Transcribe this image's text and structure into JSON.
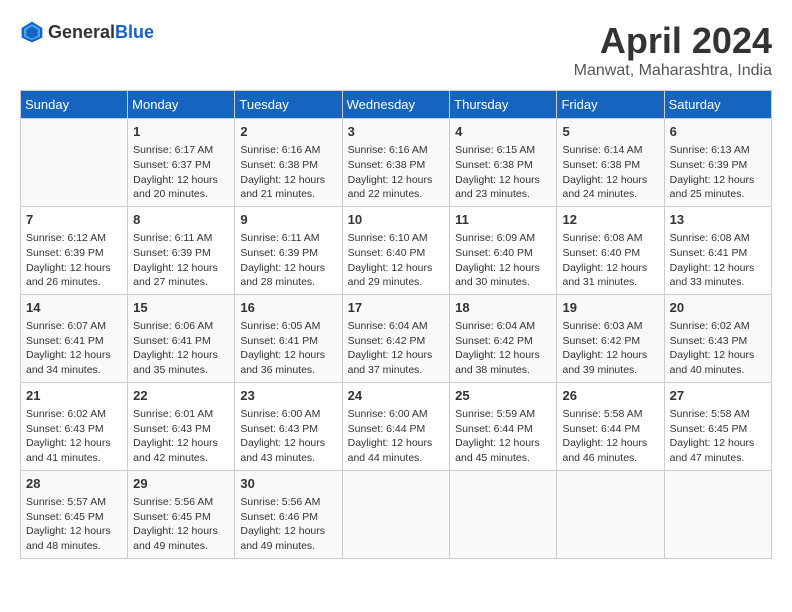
{
  "header": {
    "logo_general": "General",
    "logo_blue": "Blue",
    "month_year": "April 2024",
    "location": "Manwat, Maharashtra, India"
  },
  "calendar": {
    "days_of_week": [
      "Sunday",
      "Monday",
      "Tuesday",
      "Wednesday",
      "Thursday",
      "Friday",
      "Saturday"
    ],
    "weeks": [
      [
        {
          "day": "",
          "info": ""
        },
        {
          "day": "1",
          "info": "Sunrise: 6:17 AM\nSunset: 6:37 PM\nDaylight: 12 hours\nand 20 minutes."
        },
        {
          "day": "2",
          "info": "Sunrise: 6:16 AM\nSunset: 6:38 PM\nDaylight: 12 hours\nand 21 minutes."
        },
        {
          "day": "3",
          "info": "Sunrise: 6:16 AM\nSunset: 6:38 PM\nDaylight: 12 hours\nand 22 minutes."
        },
        {
          "day": "4",
          "info": "Sunrise: 6:15 AM\nSunset: 6:38 PM\nDaylight: 12 hours\nand 23 minutes."
        },
        {
          "day": "5",
          "info": "Sunrise: 6:14 AM\nSunset: 6:38 PM\nDaylight: 12 hours\nand 24 minutes."
        },
        {
          "day": "6",
          "info": "Sunrise: 6:13 AM\nSunset: 6:39 PM\nDaylight: 12 hours\nand 25 minutes."
        }
      ],
      [
        {
          "day": "7",
          "info": "Sunrise: 6:12 AM\nSunset: 6:39 PM\nDaylight: 12 hours\nand 26 minutes."
        },
        {
          "day": "8",
          "info": "Sunrise: 6:11 AM\nSunset: 6:39 PM\nDaylight: 12 hours\nand 27 minutes."
        },
        {
          "day": "9",
          "info": "Sunrise: 6:11 AM\nSunset: 6:39 PM\nDaylight: 12 hours\nand 28 minutes."
        },
        {
          "day": "10",
          "info": "Sunrise: 6:10 AM\nSunset: 6:40 PM\nDaylight: 12 hours\nand 29 minutes."
        },
        {
          "day": "11",
          "info": "Sunrise: 6:09 AM\nSunset: 6:40 PM\nDaylight: 12 hours\nand 30 minutes."
        },
        {
          "day": "12",
          "info": "Sunrise: 6:08 AM\nSunset: 6:40 PM\nDaylight: 12 hours\nand 31 minutes."
        },
        {
          "day": "13",
          "info": "Sunrise: 6:08 AM\nSunset: 6:41 PM\nDaylight: 12 hours\nand 33 minutes."
        }
      ],
      [
        {
          "day": "14",
          "info": "Sunrise: 6:07 AM\nSunset: 6:41 PM\nDaylight: 12 hours\nand 34 minutes."
        },
        {
          "day": "15",
          "info": "Sunrise: 6:06 AM\nSunset: 6:41 PM\nDaylight: 12 hours\nand 35 minutes."
        },
        {
          "day": "16",
          "info": "Sunrise: 6:05 AM\nSunset: 6:41 PM\nDaylight: 12 hours\nand 36 minutes."
        },
        {
          "day": "17",
          "info": "Sunrise: 6:04 AM\nSunset: 6:42 PM\nDaylight: 12 hours\nand 37 minutes."
        },
        {
          "day": "18",
          "info": "Sunrise: 6:04 AM\nSunset: 6:42 PM\nDaylight: 12 hours\nand 38 minutes."
        },
        {
          "day": "19",
          "info": "Sunrise: 6:03 AM\nSunset: 6:42 PM\nDaylight: 12 hours\nand 39 minutes."
        },
        {
          "day": "20",
          "info": "Sunrise: 6:02 AM\nSunset: 6:43 PM\nDaylight: 12 hours\nand 40 minutes."
        }
      ],
      [
        {
          "day": "21",
          "info": "Sunrise: 6:02 AM\nSunset: 6:43 PM\nDaylight: 12 hours\nand 41 minutes."
        },
        {
          "day": "22",
          "info": "Sunrise: 6:01 AM\nSunset: 6:43 PM\nDaylight: 12 hours\nand 42 minutes."
        },
        {
          "day": "23",
          "info": "Sunrise: 6:00 AM\nSunset: 6:43 PM\nDaylight: 12 hours\nand 43 minutes."
        },
        {
          "day": "24",
          "info": "Sunrise: 6:00 AM\nSunset: 6:44 PM\nDaylight: 12 hours\nand 44 minutes."
        },
        {
          "day": "25",
          "info": "Sunrise: 5:59 AM\nSunset: 6:44 PM\nDaylight: 12 hours\nand 45 minutes."
        },
        {
          "day": "26",
          "info": "Sunrise: 5:58 AM\nSunset: 6:44 PM\nDaylight: 12 hours\nand 46 minutes."
        },
        {
          "day": "27",
          "info": "Sunrise: 5:58 AM\nSunset: 6:45 PM\nDaylight: 12 hours\nand 47 minutes."
        }
      ],
      [
        {
          "day": "28",
          "info": "Sunrise: 5:57 AM\nSunset: 6:45 PM\nDaylight: 12 hours\nand 48 minutes."
        },
        {
          "day": "29",
          "info": "Sunrise: 5:56 AM\nSunset: 6:45 PM\nDaylight: 12 hours\nand 49 minutes."
        },
        {
          "day": "30",
          "info": "Sunrise: 5:56 AM\nSunset: 6:46 PM\nDaylight: 12 hours\nand 49 minutes."
        },
        {
          "day": "",
          "info": ""
        },
        {
          "day": "",
          "info": ""
        },
        {
          "day": "",
          "info": ""
        },
        {
          "day": "",
          "info": ""
        }
      ]
    ]
  }
}
